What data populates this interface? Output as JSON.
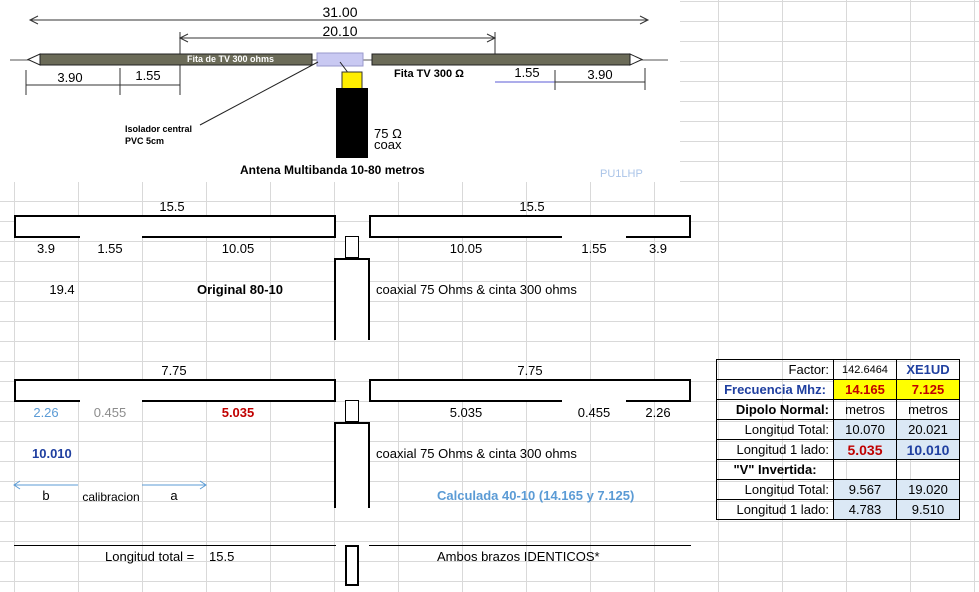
{
  "diagram": {
    "total_top": "31.00",
    "mid_top": "20.10",
    "left_ribbon_label": "Fita de TV 300 ohms",
    "right_ribbon_label": "Fita TV  300 Ω",
    "left_seg1": "3.90",
    "left_seg2": "1.55",
    "right_seg2": "1.55",
    "right_seg1": "3.90",
    "insulator_line1": "Isolador central",
    "insulator_line2": "PVC 5cm",
    "coax_line1": "75 Ω",
    "coax_line2": "coax",
    "caption": "Antena Multibanda 10-80 metros",
    "watermark": "PU1LHP"
  },
  "block1": {
    "left_total": "15.5",
    "right_total": "15.5",
    "l_a": "3.9",
    "l_b": "1.55",
    "l_c": "10.05",
    "r_c": "10.05",
    "r_b": "1.55",
    "r_a": "3.9",
    "sum": "19.4",
    "title": "Original 80-10",
    "feed": "coaxial 75 Ohms & cinta 300 ohms"
  },
  "block2": {
    "left_total": "7.75",
    "right_total": "7.75",
    "l_a": "2.26",
    "l_b": "0.455",
    "l_c": "5.035",
    "r_c": "5.035",
    "r_b": "0.455",
    "r_a": "2.26",
    "sum": "10.010",
    "feed": "coaxial 75 Ohms & cinta 300 ohms",
    "b_label": "b",
    "cal_label": "calibracion",
    "a_label": "a",
    "calc_title": "Calculada 40-10 (14.165 y 7.125)"
  },
  "footer": {
    "total_label": "Longitud total =",
    "total_value": "15.5",
    "note": "Ambos brazos IDENTICOS*"
  },
  "table": {
    "factor_label": "Factor:",
    "factor_value": "142.6464",
    "callsign": "XE1UD",
    "freq_label": "Frecuencia Mhz:",
    "freq1": "14.165",
    "freq2": "7.125",
    "dipolo_label": "Dipolo Normal:",
    "unit1": "metros",
    "unit2": "metros",
    "lt_label": "Longitud Total:",
    "lt1": "10.070",
    "lt2": "20.021",
    "l1_label": "Longitud 1 lado:",
    "l1a": "5.035",
    "l1b": "10.010",
    "v_label": "\"V\" Invertida:",
    "vlt_label": "Longitud Total:",
    "vlt1": "9.567",
    "vlt2": "19.020",
    "vl1_label": "Longitud 1 lado:",
    "vl1a": "4.783",
    "vl1b": "9.510"
  },
  "colors": {
    "accent_blue": "#5b9bd5",
    "dark_red": "#c00000",
    "navy": "#1f3fa0",
    "yellow": "#ffff00",
    "light_blue_fill": "#dbe8f5"
  }
}
